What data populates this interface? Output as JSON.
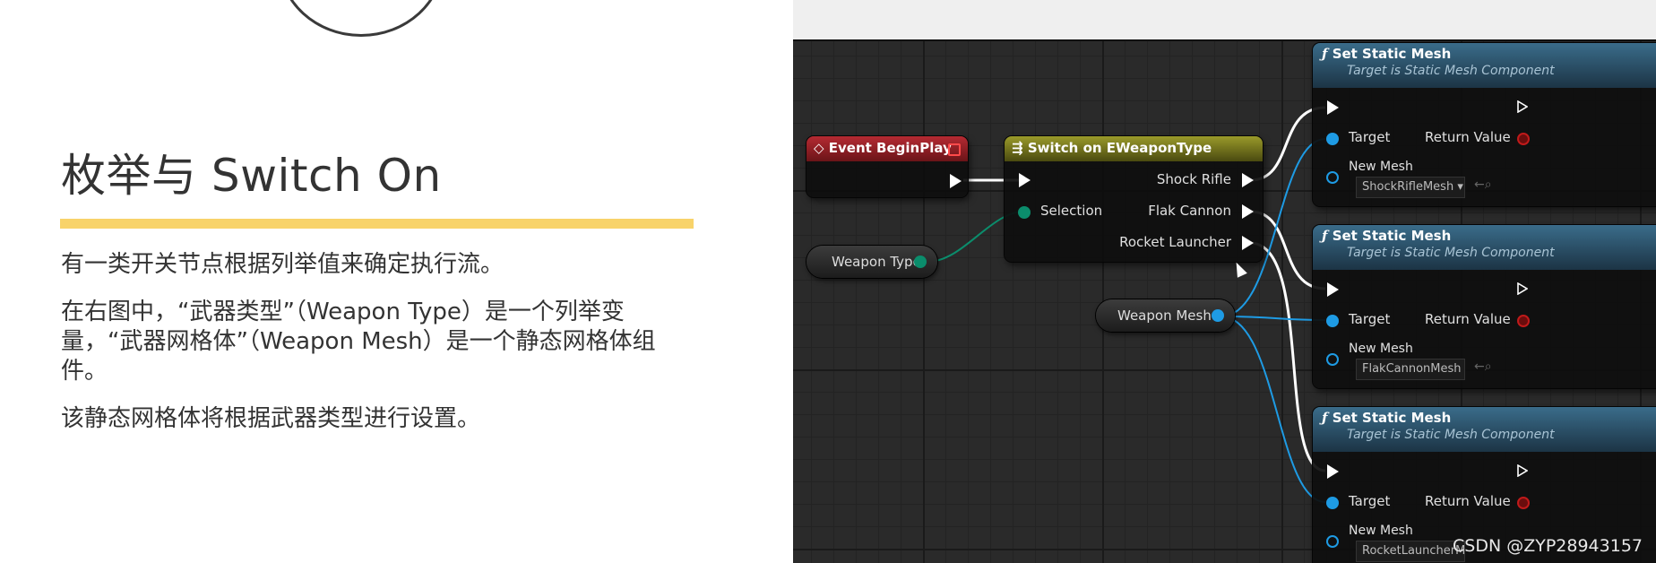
{
  "slide": {
    "title": "枚举与 Switch On",
    "paragraphs": [
      "有一类开关节点根据列举值来确定执行流。",
      "在右图中，“武器类型”（Weapon Type）是一个列举变量，“武器网格体”（Weapon Mesh）是一个静态网格体组件。",
      "该静态网格体将根据武器类型进行设置。"
    ],
    "accent_color": "#f8d36a"
  },
  "blueprint": {
    "event_node": {
      "title": "Event BeginPlay",
      "icon": "event-diamond-icon"
    },
    "switch_node": {
      "title": "Switch on EWeaponType",
      "icon": "switch-icon",
      "selection_label": "Selection",
      "outputs": [
        "Shock Rifle",
        "Flak Cannon",
        "Rocket Launcher"
      ]
    },
    "weapon_type_var": {
      "label": "Weapon Type"
    },
    "weapon_mesh_var": {
      "label": "Weapon Mesh"
    },
    "set_mesh_nodes": [
      {
        "title": "Set Static Mesh",
        "subtitle": "Target is Static Mesh Component",
        "target_label": "Target",
        "return_label": "Return Value",
        "new_mesh_label": "New Mesh",
        "mesh_value": "ShockRifleMesh"
      },
      {
        "title": "Set Static Mesh",
        "subtitle": "Target is Static Mesh Component",
        "target_label": "Target",
        "return_label": "Return Value",
        "new_mesh_label": "New Mesh",
        "mesh_value": "FlakCannonMesh"
      },
      {
        "title": "Set Static Mesh",
        "subtitle": "Target is Static Mesh Component",
        "target_label": "Target",
        "return_label": "Return Value",
        "new_mesh_label": "New Mesh",
        "mesh_value": "RocketLauncherMesh"
      }
    ],
    "colors": {
      "event": "#b52a32",
      "switch": "#9a9a2a",
      "function": "#3a6c8a",
      "object_pin": "#1e9be4",
      "enum_pin": "#0b8d6c"
    }
  },
  "watermark": "CSDN @ZYP28943157"
}
